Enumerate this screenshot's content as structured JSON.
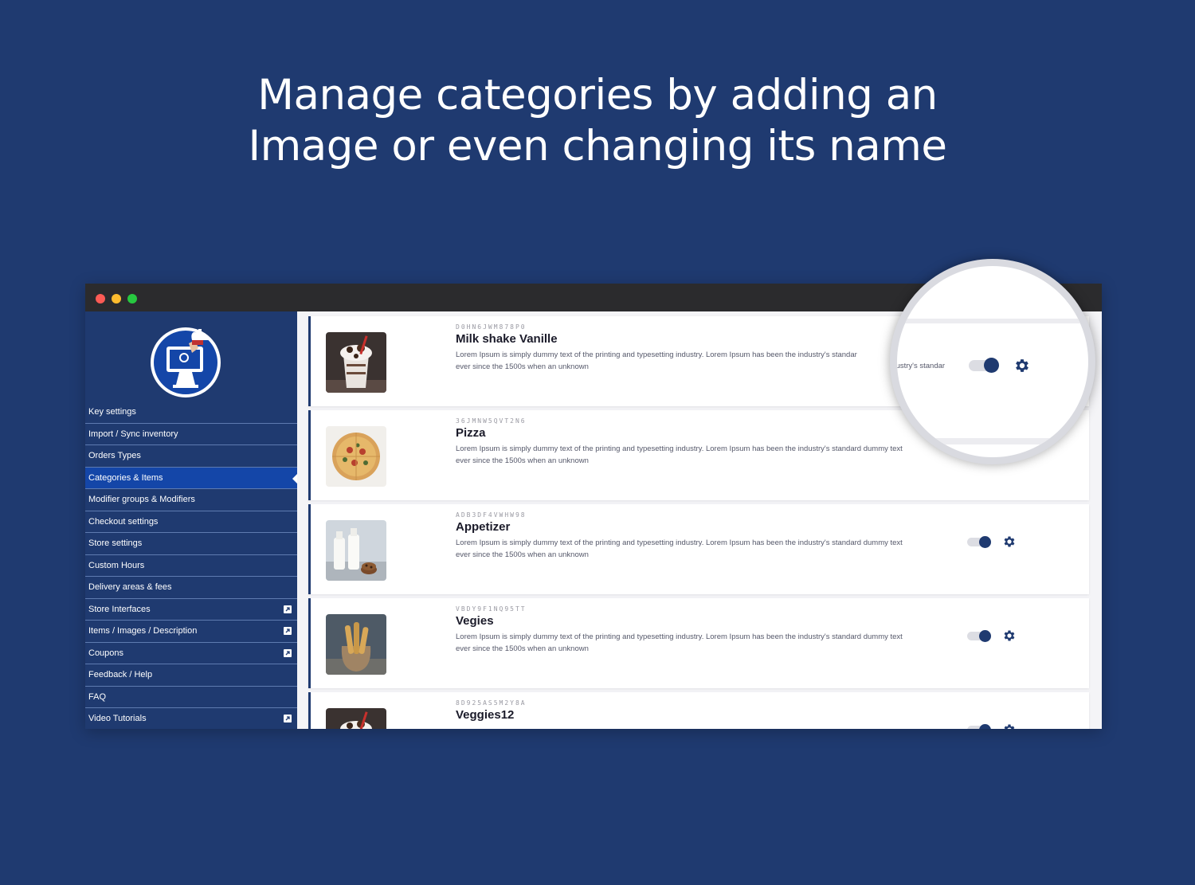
{
  "headline": {
    "line1": "Manage categories by adding an",
    "line2": "Image or even changing its name"
  },
  "colors": {
    "background": "#1f3a70",
    "sidebar": "#1f3a70",
    "active_item": "#1446a8",
    "accent": "#1f3a70",
    "window_bar": "#2b2b2d"
  },
  "sidebar": {
    "logo_icon": "restaurant-computer-logo",
    "items": [
      {
        "label": "Key settings",
        "external": false
      },
      {
        "label": "Import / Sync inventory",
        "external": false
      },
      {
        "label": "Orders Types",
        "external": false
      },
      {
        "label": "Categories & Items",
        "external": false,
        "active": true
      },
      {
        "label": "Modifier groups & Modifiers",
        "external": false
      },
      {
        "label": "Checkout settings",
        "external": false
      },
      {
        "label": "Store settings",
        "external": false
      },
      {
        "label": "Custom Hours",
        "external": false
      },
      {
        "label": "Delivery areas & fees",
        "external": false
      },
      {
        "label": "Store Interfaces",
        "external": true
      },
      {
        "label": "Items / Images / Description",
        "external": true
      },
      {
        "label": "Coupons",
        "external": true
      },
      {
        "label": "Feedback / Help",
        "external": false
      },
      {
        "label": "FAQ",
        "external": false
      },
      {
        "label": "Video Tutorials",
        "external": true
      }
    ]
  },
  "categories": [
    {
      "code": "D0HN6JWM878P0",
      "name": "Milk shake Vanille",
      "desc1": "Lorem Ipsum is simply dummy text of the printing and typesetting industry. Lorem Ipsum has been the industry's standar",
      "desc2": "ever since the 1500s when an unknown",
      "image": "milkshake",
      "enabled": true
    },
    {
      "code": "36JMNW5QVT2N6",
      "name": "Pizza",
      "desc1": "Lorem Ipsum is simply dummy text of the printing and typesetting industry. Lorem Ipsum has been the industry's standard dummy text",
      "desc2": "ever since the 1500s when an unknown",
      "image": "pizza",
      "enabled": true
    },
    {
      "code": "ADB3DF4VWHW98",
      "name": "Appetizer",
      "desc1": "Lorem Ipsum is simply dummy text of the printing and typesetting industry. Lorem Ipsum has been the industry's standard dummy text",
      "desc2": "ever since the 1500s when an unknown",
      "image": "milk-bottles",
      "enabled": true
    },
    {
      "code": "VBDY9F1NQ95TT",
      "name": "Vegies",
      "desc1": "Lorem Ipsum is simply dummy text of the printing and typesetting industry. Lorem Ipsum has been the industry's standard dummy text",
      "desc2": "ever since the 1500s when an unknown",
      "image": "breadsticks",
      "enabled": true
    },
    {
      "code": "8D925AS5M2Y8A",
      "name": "Veggies12",
      "desc1": "",
      "desc2": "",
      "image": "milkshake",
      "enabled": true
    }
  ],
  "magnifier": {
    "desc_fragment": "ndustry's standar"
  }
}
